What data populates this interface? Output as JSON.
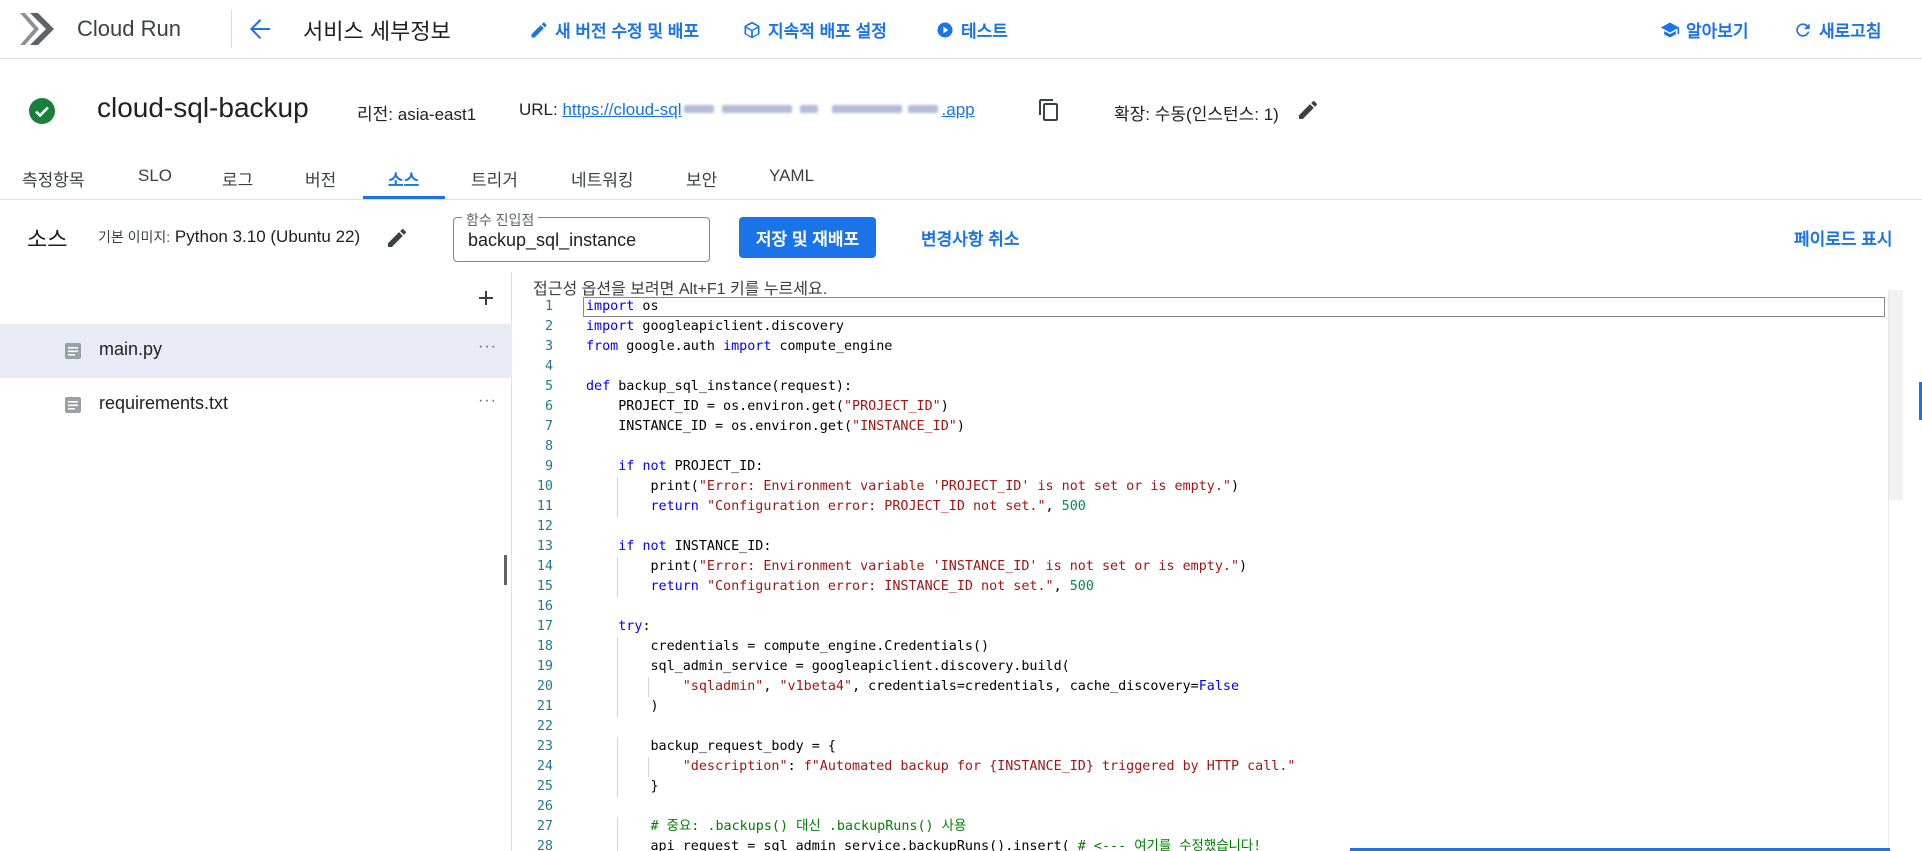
{
  "app": {
    "product_name": "Cloud Run",
    "page_title": "서비스 세부정보",
    "actions": {
      "edit_deploy": "새 버전 수정 및 배포",
      "continuous_deploy": "지속적 배포 설정",
      "test": "테스트",
      "learn": "알아보기",
      "refresh": "새로고침"
    }
  },
  "service": {
    "name": "cloud-sql-backup",
    "status": "ok",
    "region_label": "리전:",
    "region": "asia-east1",
    "url_label": "URL:",
    "url_prefix": "https://cloud-sql",
    "url_suffix": ".app",
    "scale_label": "확장:",
    "scale_value": "수동(인스턴스: 1)"
  },
  "tabs": [
    "측정항목",
    "SLO",
    "로그",
    "버전",
    "소스",
    "트리거",
    "네트워킹",
    "보안",
    "YAML"
  ],
  "active_tab": "소스",
  "source": {
    "title": "소스",
    "base_image_label": "기본 이미지:",
    "base_image_value": "Python 3.10 (Ubuntu 22)",
    "entry_label": "함수 진입점",
    "entry_value": "backup_sql_instance",
    "save_button": "저장 및 재배포",
    "cancel_button": "변경사항 취소",
    "payload_button": "페이로드 표시",
    "accessibility_hint": "접근성 옵션을 보려면 Alt+F1 키를 누르세요."
  },
  "files": [
    {
      "name": "main.py",
      "selected": true,
      "more": "···"
    },
    {
      "name": "requirements.txt",
      "selected": false,
      "more": "···"
    }
  ],
  "editor": {
    "lines": [
      "import os",
      "import googleapiclient.discovery",
      "from google.auth import compute_engine",
      "",
      "def backup_sql_instance(request):",
      "    PROJECT_ID = os.environ.get(\"PROJECT_ID\")",
      "    INSTANCE_ID = os.environ.get(\"INSTANCE_ID\")",
      "",
      "    if not PROJECT_ID:",
      "        print(\"Error: Environment variable 'PROJECT_ID' is not set or is empty.\")",
      "        return \"Configuration error: PROJECT_ID not set.\", 500",
      "",
      "    if not INSTANCE_ID:",
      "        print(\"Error: Environment variable 'INSTANCE_ID' is not set or is empty.\")",
      "        return \"Configuration error: INSTANCE_ID not set.\", 500",
      "",
      "    try:",
      "        credentials = compute_engine.Credentials()",
      "        sql_admin_service = googleapiclient.discovery.build(",
      "            \"sqladmin\", \"v1beta4\", credentials=credentials, cache_discovery=False",
      "        )",
      "",
      "        backup_request_body = {",
      "            \"description\": f\"Automated backup for {INSTANCE_ID} triggered by HTTP call.\"",
      "        }",
      "",
      "        # 중요: .backups() 대신 .backupRuns() 사용",
      "        api_request = sql_admin_service.backupRuns().insert( # <--- 여기를 수정했습니다!"
    ]
  },
  "colors": {
    "accent": "#1a73e8",
    "success": "#188038",
    "keyword": "#0000ff",
    "string": "#a31515",
    "number": "#098658",
    "comment": "#008000",
    "line_number": "#237893"
  }
}
